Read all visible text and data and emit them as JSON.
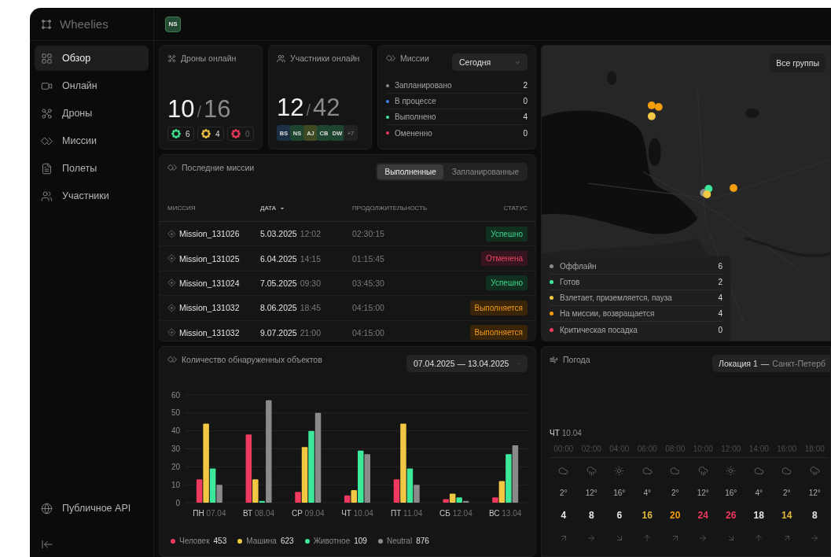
{
  "app": {
    "name": "Wheelies",
    "user_initials": "NS"
  },
  "sidebar": {
    "items": [
      {
        "label": "Обзор",
        "selected": true
      },
      {
        "label": "Онлайн",
        "selected": false
      },
      {
        "label": "Дроны",
        "selected": false
      },
      {
        "label": "Миссии",
        "selected": false
      },
      {
        "label": "Полеты",
        "selected": false
      },
      {
        "label": "Участники",
        "selected": false
      }
    ],
    "footer_link": "Публичное API"
  },
  "drones_card": {
    "title": "Дроны онлайн",
    "online": "10",
    "separator": "/",
    "total": "16",
    "states": [
      {
        "count": "6",
        "color": "#3ee89a",
        "dim": false
      },
      {
        "count": "4",
        "color": "#f2c744",
        "dim": false
      },
      {
        "count": "0",
        "color": "#f0395e",
        "dim": true
      }
    ]
  },
  "participants_card": {
    "title": "Участники онлайн",
    "online": "12",
    "separator": "/",
    "total": "42",
    "avatars": [
      {
        "initials": "BS",
        "color": "#1c2f45"
      },
      {
        "initials": "NS",
        "color": "#1d4530"
      },
      {
        "initials": "AJ",
        "color": "#3f4a22"
      },
      {
        "initials": "CB",
        "color": "#1d4530"
      },
      {
        "initials": "DW",
        "color": "#1d4530"
      }
    ],
    "more": "+7"
  },
  "missions_card": {
    "title": "Миссии",
    "period": "Сегодня",
    "rows": [
      {
        "label": "Запланировано",
        "count": "2",
        "color": "#8a8a8a"
      },
      {
        "label": "В процессе",
        "count": "0",
        "color": "#3b82f6"
      },
      {
        "label": "Выполнено",
        "count": "4",
        "color": "#3ee89a"
      },
      {
        "label": "Омененно",
        "count": "0",
        "color": "#f0395e"
      }
    ]
  },
  "recent_missions": {
    "title": "Последние миссии",
    "tabs": [
      {
        "label": "Выполненные",
        "selected": true
      },
      {
        "label": "Запланированные",
        "selected": false
      }
    ],
    "columns": [
      {
        "label": "МИССИЯ",
        "sorted": false
      },
      {
        "label": "ДАТА",
        "sorted": true
      },
      {
        "label": "ПРОДОЛЖИТЕЛЬНОСТЬ",
        "sorted": false
      },
      {
        "label": "СТАТУС",
        "sorted": false
      }
    ],
    "rows": [
      {
        "mission": "Mission_131026",
        "date": "5.03.2025",
        "time": "12:02",
        "duration": "02:30:15",
        "status": {
          "label": "Успешно",
          "kind": "success"
        }
      },
      {
        "mission": "Mission_131025",
        "date": "6.04.2025",
        "time": "14:15",
        "duration": "01:15:45",
        "status": {
          "label": "Отменена",
          "kind": "cancelled"
        }
      },
      {
        "mission": "Mission_131024",
        "date": "7.05.2025",
        "time": "09:30",
        "duration": "03:45:30",
        "status": {
          "label": "Успешно",
          "kind": "success"
        }
      },
      {
        "mission": "Mission_131032",
        "date": "8.06.2025",
        "time": "18:45",
        "duration": "04:15:00",
        "status": {
          "label": "Выполняется",
          "kind": "running"
        }
      },
      {
        "mission": "Mission_131032",
        "date": "9.07.2025",
        "time": "21:00",
        "duration": "04:15:00",
        "status": {
          "label": "Выполняется",
          "kind": "running"
        }
      }
    ]
  },
  "objects_card": {
    "title": "Количество обнаруженных объектов",
    "date_range": "07.04.2025 — 13.04.2025",
    "chart_data": {
      "type": "bar",
      "categories": [
        "ПН 07.04",
        "ВТ 08.04",
        "СР 09.04",
        "ЧТ 10.04",
        "ПТ 11.04",
        "СБ 12.04",
        "ВС 13.04"
      ],
      "ylim": [
        0,
        60
      ],
      "grid": true,
      "yticks": [
        0,
        10,
        20,
        30,
        40,
        50,
        60
      ],
      "series": [
        {
          "name": "Человек",
          "color": "#f0395e",
          "values": [
            13,
            38,
            6,
            4,
            13,
            2,
            3
          ]
        },
        {
          "name": "Машина",
          "color": "#f2c744",
          "values": [
            44,
            13,
            31,
            7,
            44,
            5,
            12
          ]
        },
        {
          "name": "Животное",
          "color": "#3ee89a",
          "values": [
            19,
            1,
            40,
            29,
            19,
            3,
            27
          ]
        },
        {
          "name": "Neutral",
          "color": "#8a8a8a",
          "values": [
            10,
            57,
            50,
            27,
            10,
            1,
            32
          ]
        }
      ]
    },
    "legend_totals": [
      "453",
      "623",
      "109",
      "876"
    ]
  },
  "map_card": {
    "group_filter": "Все группы",
    "legend": [
      {
        "label": "Оффлайн",
        "count": "6",
        "color": "#8a8a8a"
      },
      {
        "label": "Готов",
        "count": "2",
        "color": "#3ee89a"
      },
      {
        "label": "Взлетает, приземляется, пауза",
        "count": "4",
        "color": "#f2c744"
      },
      {
        "label": "На миссии, возвращается",
        "count": "4",
        "color": "#f59e0b"
      },
      {
        "label": "Критическая посадка",
        "count": "0",
        "color": "#f0395e"
      }
    ]
  },
  "weather_card": {
    "title": "Погода",
    "location": "Локация 1",
    "separator": "—",
    "city": "Санкт-Петерб",
    "day": "ЧТ",
    "date": "10.04",
    "hours": [
      {
        "time": "00:00",
        "kind": "cloud",
        "temp": "2°",
        "wind": {
          "speed": "4",
          "color": "#e6e6e6",
          "kind": "ne"
        }
      },
      {
        "time": "02:00",
        "kind": "rain",
        "temp": "12°",
        "wind": {
          "speed": "8",
          "color": "#e6e6e6",
          "kind": "e"
        }
      },
      {
        "time": "04:00",
        "kind": "sun",
        "temp": "16°",
        "wind": {
          "speed": "6",
          "color": "#e6e6e6",
          "kind": "se"
        }
      },
      {
        "time": "06:00",
        "kind": "cloud",
        "temp": "4°",
        "wind": {
          "speed": "16",
          "color": "#e2b93b",
          "kind": "n"
        }
      },
      {
        "time": "08:00",
        "kind": "cloud",
        "temp": "2°",
        "wind": {
          "speed": "20",
          "color": "#f59e0b",
          "kind": "ne"
        }
      },
      {
        "time": "10:00",
        "kind": "rain",
        "temp": "12°",
        "wind": {
          "speed": "24",
          "color": "#f0395e",
          "kind": "e"
        }
      },
      {
        "time": "12:00",
        "kind": "sun",
        "temp": "16°",
        "wind": {
          "speed": "26",
          "color": "#f0395e",
          "kind": "se"
        }
      },
      {
        "time": "14:00",
        "kind": "cloud",
        "temp": "4°",
        "wind": {
          "speed": "18",
          "color": "#e6e6e6",
          "kind": "n"
        }
      },
      {
        "time": "16:00",
        "kind": "cloud",
        "temp": "2°",
        "wind": {
          "speed": "14",
          "color": "#e2b93b",
          "kind": "ne"
        }
      },
      {
        "time": "18:00",
        "kind": "rain",
        "temp": "12°",
        "wind": {
          "speed": "8",
          "color": "#e6e6e6",
          "kind": "e"
        }
      }
    ]
  }
}
